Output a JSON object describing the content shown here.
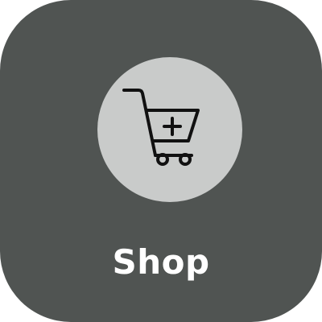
{
  "tile": {
    "label": "Shop",
    "icon": "cart-plus-icon",
    "colors": {
      "background": "#505452",
      "icon_circle": "#c9cbca",
      "icon_stroke": "#111111",
      "label": "#ffffff"
    }
  }
}
